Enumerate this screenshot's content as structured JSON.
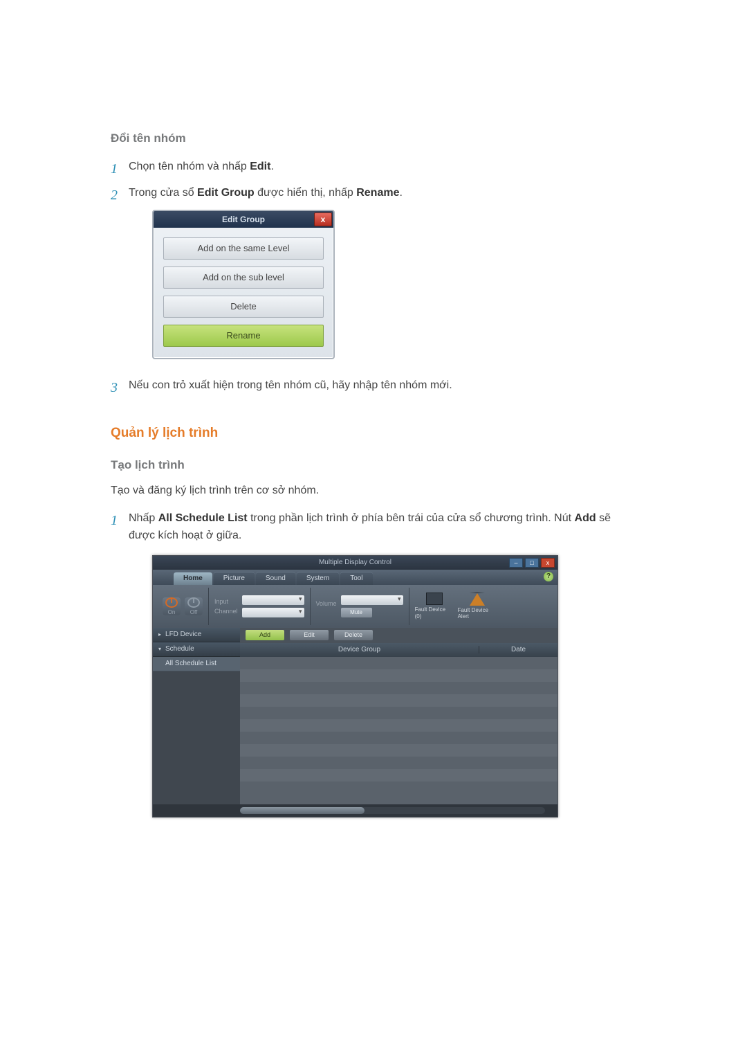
{
  "headings": {
    "rename_group": "Đổi tên nhóm",
    "manage_schedule": "Quản lý lịch trình",
    "create_schedule": "Tạo lịch trình"
  },
  "rename_steps": [
    {
      "num": "1",
      "pre": "Chọn tên nhóm và nhấp ",
      "bold": "Edit",
      "post": "."
    },
    {
      "num": "2",
      "pre": "Trong cửa sổ ",
      "bold": "Edit Group",
      "mid": " được hiển thị, nhấp ",
      "bold2": "Rename",
      "post": "."
    },
    {
      "num": "3",
      "pre": "Nếu con trỏ xuất hiện trong tên nhóm cũ, hãy nhập tên nhóm mới."
    }
  ],
  "create_paragraph": "Tạo và đăng ký lịch trình trên cơ sở nhóm.",
  "create_steps": [
    {
      "num": "1",
      "pre": "Nhấp ",
      "bold": "All Schedule List",
      "mid": " trong phần lịch trình ở phía bên trái của cửa sổ chương trình. Nút ",
      "bold2": "Add",
      "post": " sẽ được kích hoạt ở giữa."
    }
  ],
  "dialog": {
    "title": "Edit Group",
    "close": "x",
    "btn_same": "Add on the same Level",
    "btn_sub": "Add on the sub level",
    "btn_delete": "Delete",
    "btn_rename": "Rename"
  },
  "mdc": {
    "title": "Multiple Display Control",
    "win": {
      "min": "–",
      "max": "□",
      "close": "x"
    },
    "help": "?",
    "tabs": {
      "home": "Home",
      "picture": "Picture",
      "sound": "Sound",
      "system": "System",
      "tool": "Tool"
    },
    "ribbon": {
      "power_on": "On",
      "power_off": "Off",
      "input_label": "Input",
      "channel_label": "Channel",
      "volume_label": "Volume",
      "mute_btn": "Mute",
      "fault0": "Fault Device (0)",
      "fault_alert": "Fault Device Alert"
    },
    "side": {
      "lfd": "LFD Device",
      "schedule": "Schedule",
      "all_list": "All Schedule List"
    },
    "tools": {
      "add": "Add",
      "edit": "Edit",
      "delete": "Delete"
    },
    "grid": {
      "col_device_group": "Device Group",
      "col_date": "Date"
    }
  }
}
